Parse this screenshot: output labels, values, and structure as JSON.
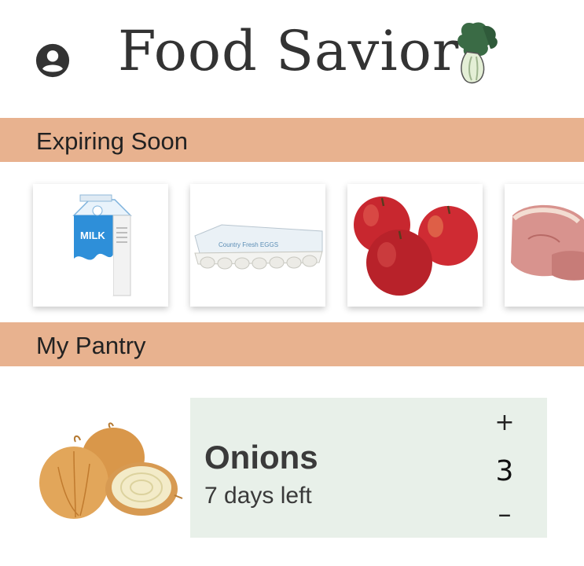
{
  "header": {
    "title": "Food Savior",
    "profile_icon": "account-circle-icon",
    "logo_icon": "bok-choy-logo-icon"
  },
  "sections": {
    "expiring": {
      "label": "Expiring Soon"
    },
    "pantry": {
      "label": "My Pantry"
    }
  },
  "expiring_items": [
    {
      "name": "milk",
      "image": "milk-carton"
    },
    {
      "name": "eggs",
      "image": "egg-carton"
    },
    {
      "name": "apples",
      "image": "apples"
    },
    {
      "name": "pork",
      "image": "pork-chops"
    }
  ],
  "pantry_items": [
    {
      "name": "Onions",
      "days_left": "7 days left",
      "quantity": "3",
      "image": "onions"
    }
  ],
  "stepper": {
    "plus": "+",
    "minus": "–"
  },
  "colors": {
    "section_bar": "#e8b28f",
    "item_panel": "#e8f0e9",
    "text": "#333333",
    "logo_green": "#3a6b45"
  }
}
